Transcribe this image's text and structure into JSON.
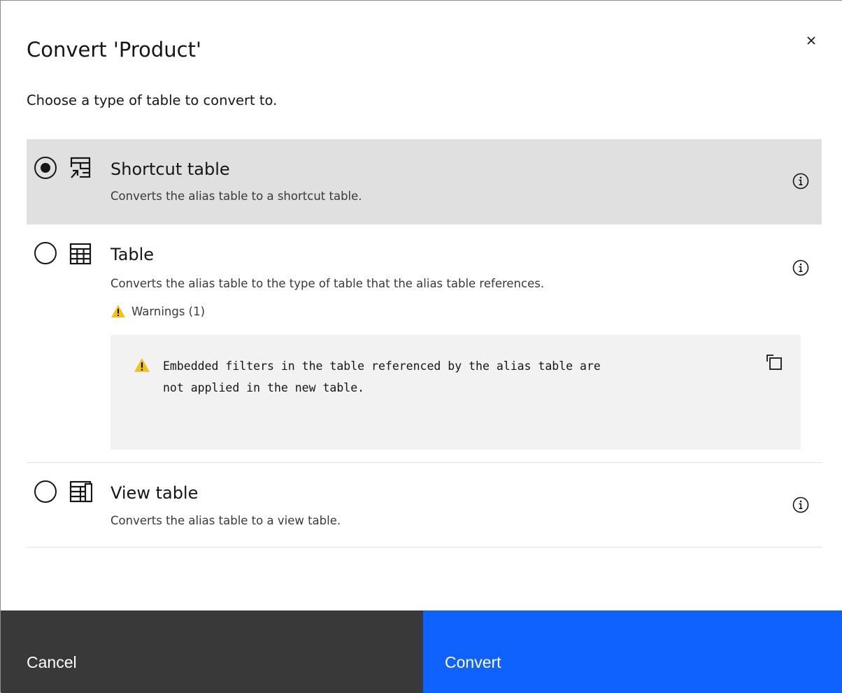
{
  "modal": {
    "title": "Convert 'Product'",
    "subtitle": "Choose a type of table to convert to.",
    "close_icon": "close-icon"
  },
  "options": [
    {
      "title": "Shortcut table",
      "description": "Converts the alias table to a shortcut table.",
      "icon": "shortcut-table-icon",
      "selected": true
    },
    {
      "title": "Table",
      "description": "Converts the alias table to the type of table that the alias table references.",
      "icon": "table-icon",
      "selected": false,
      "warnings_label": "Warnings (1)",
      "warning_message": "Embedded filters in the table referenced by the alias table are\nnot applied in the new table."
    },
    {
      "title": "View table",
      "description": "Converts the alias table to a view table.",
      "icon": "view-table-icon",
      "selected": false
    }
  ],
  "footer": {
    "cancel_label": "Cancel",
    "convert_label": "Convert"
  },
  "colors": {
    "primary": "#0f62fe",
    "secondary": "#393939",
    "selected_bg": "#e0e0e0",
    "warning": "#f1c21b"
  }
}
